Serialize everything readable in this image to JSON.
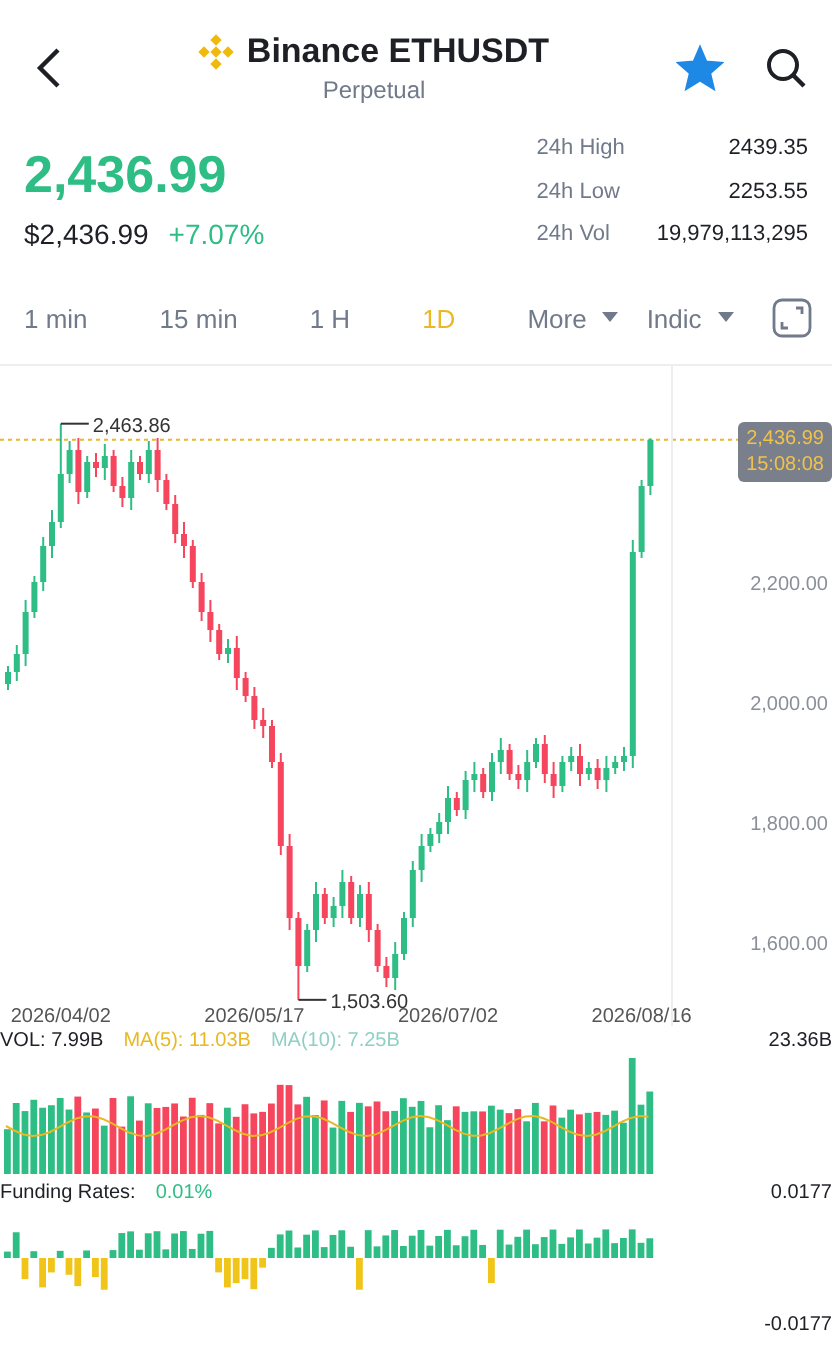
{
  "header": {
    "title": "Binance ETHUSDT",
    "subtitle": "Perpetual",
    "favorite": true
  },
  "price": {
    "last": "2,436.99",
    "usd": "$2,436.99",
    "change": "+7.07%"
  },
  "stats": [
    {
      "label": "24h High",
      "value": "2439.35"
    },
    {
      "label": "24h Low",
      "value": "2253.55"
    },
    {
      "label": "24h Vol",
      "value": "19,979,113,295"
    }
  ],
  "intervals": [
    {
      "label": "1 min",
      "selected": false
    },
    {
      "label": "15 min",
      "selected": false
    },
    {
      "label": "1 H",
      "selected": false
    },
    {
      "label": "1D",
      "selected": true
    }
  ],
  "dropdowns": [
    {
      "label": "More"
    },
    {
      "label": "Indic"
    }
  ],
  "chart": {
    "chart_data": {
      "type": "candlestick",
      "categories": [
        null,
        null,
        null,
        null,
        null,
        null,
        "2026/04/02",
        null,
        null,
        null,
        null,
        null,
        null,
        null,
        null,
        null,
        null,
        null,
        null,
        null,
        null,
        null,
        null,
        null,
        null,
        null,
        null,
        null,
        "2026/05/17",
        null,
        null,
        null,
        null,
        null,
        null,
        null,
        null,
        null,
        null,
        null,
        null,
        null,
        null,
        null,
        null,
        null,
        null,
        null,
        null,
        null,
        "2026/07/02",
        null,
        null,
        null,
        null,
        null,
        null,
        null,
        null,
        null,
        null,
        null,
        null,
        null,
        null,
        null,
        null,
        null,
        null,
        null,
        null,
        null,
        "2026/08/16",
        null
      ],
      "ohlc": [
        [
          2030,
          2060,
          2020,
          2050
        ],
        [
          2050,
          2095,
          2035,
          2080
        ],
        [
          2080,
          2170,
          2060,
          2150
        ],
        [
          2150,
          2210,
          2140,
          2200
        ],
        [
          2200,
          2275,
          2185,
          2260
        ],
        [
          2260,
          2320,
          2240,
          2300
        ],
        [
          2300,
          2463.86,
          2290,
          2380
        ],
        [
          2380,
          2435,
          2365,
          2420
        ],
        [
          2420,
          2440,
          2330,
          2350
        ],
        [
          2350,
          2410,
          2340,
          2400
        ],
        [
          2400,
          2415,
          2375,
          2390
        ],
        [
          2390,
          2430,
          2370,
          2410
        ],
        [
          2410,
          2420,
          2350,
          2360
        ],
        [
          2360,
          2375,
          2325,
          2340
        ],
        [
          2340,
          2420,
          2320,
          2400
        ],
        [
          2400,
          2410,
          2370,
          2380
        ],
        [
          2380,
          2435,
          2365,
          2420
        ],
        [
          2420,
          2440,
          2350,
          2370
        ],
        [
          2370,
          2380,
          2320,
          2330
        ],
        [
          2330,
          2345,
          2265,
          2280
        ],
        [
          2280,
          2300,
          2240,
          2260
        ],
        [
          2260,
          2270,
          2190,
          2200
        ],
        [
          2200,
          2215,
          2135,
          2150
        ],
        [
          2150,
          2170,
          2100,
          2120
        ],
        [
          2120,
          2130,
          2070,
          2080
        ],
        [
          2080,
          2105,
          2065,
          2090
        ],
        [
          2090,
          2110,
          2020,
          2040
        ],
        [
          2040,
          2050,
          2000,
          2010
        ],
        [
          2010,
          2025,
          1955,
          1970
        ],
        [
          1970,
          1990,
          1940,
          1960
        ],
        [
          1960,
          1970,
          1890,
          1900
        ],
        [
          1900,
          1915,
          1745,
          1760
        ],
        [
          1760,
          1780,
          1620,
          1640
        ],
        [
          1640,
          1650,
          1503.6,
          1560
        ],
        [
          1560,
          1630,
          1550,
          1620
        ],
        [
          1620,
          1700,
          1600,
          1680
        ],
        [
          1680,
          1690,
          1630,
          1640
        ],
        [
          1640,
          1675,
          1625,
          1660
        ],
        [
          1660,
          1720,
          1640,
          1700
        ],
        [
          1700,
          1710,
          1630,
          1640
        ],
        [
          1640,
          1695,
          1625,
          1680
        ],
        [
          1680,
          1700,
          1600,
          1620
        ],
        [
          1620,
          1630,
          1550,
          1560
        ],
        [
          1560,
          1575,
          1525,
          1540
        ],
        [
          1540,
          1600,
          1520,
          1580
        ],
        [
          1580,
          1650,
          1570,
          1640
        ],
        [
          1640,
          1735,
          1625,
          1720
        ],
        [
          1720,
          1780,
          1700,
          1760
        ],
        [
          1760,
          1790,
          1750,
          1780
        ],
        [
          1780,
          1815,
          1765,
          1800
        ],
        [
          1800,
          1860,
          1780,
          1840
        ],
        [
          1840,
          1850,
          1810,
          1820
        ],
        [
          1820,
          1885,
          1805,
          1870
        ],
        [
          1870,
          1900,
          1850,
          1880
        ],
        [
          1880,
          1890,
          1840,
          1850
        ],
        [
          1850,
          1915,
          1835,
          1900
        ],
        [
          1900,
          1940,
          1880,
          1920
        ],
        [
          1920,
          1930,
          1870,
          1880
        ],
        [
          1880,
          1895,
          1855,
          1870
        ],
        [
          1870,
          1920,
          1850,
          1900
        ],
        [
          1900,
          1940,
          1890,
          1930
        ],
        [
          1930,
          1945,
          1865,
          1880
        ],
        [
          1880,
          1900,
          1840,
          1860
        ],
        [
          1860,
          1910,
          1850,
          1900
        ],
        [
          1900,
          1925,
          1885,
          1910
        ],
        [
          1910,
          1930,
          1860,
          1880
        ],
        [
          1880,
          1900,
          1870,
          1890
        ],
        [
          1890,
          1905,
          1855,
          1870
        ],
        [
          1870,
          1910,
          1850,
          1890
        ],
        [
          1890,
          1910,
          1880,
          1900
        ],
        [
          1900,
          1925,
          1885,
          1910
        ],
        [
          1910,
          2270,
          1890,
          2250
        ],
        [
          2250,
          2370,
          2240,
          2360
        ],
        [
          2360,
          2439.35,
          2345,
          2436.99
        ]
      ],
      "ref_lines": [
        {
          "axis": "y",
          "value": 2436.99,
          "color": "#e8b923"
        }
      ],
      "ylim": [
        1460,
        2560
      ],
      "yticks": [
        {
          "value": 1600,
          "label": "1,600.00"
        },
        {
          "value": 1800,
          "label": "1,800.00"
        },
        {
          "value": 2000,
          "label": "2,000.00"
        },
        {
          "value": 2200,
          "label": "2,200.00"
        }
      ],
      "annotations": [
        "2,463.86",
        "1,503.60"
      ]
    },
    "last_tag": {
      "price": "2,436.99",
      "countdown": "15:08:08"
    }
  },
  "volume": {
    "label": "VOL: 7.99B",
    "ma5": "MA(5): 11.03B",
    "ma10": "MA(10): 7.25B",
    "max": "23.36B"
  },
  "funding": {
    "label": "Funding Rates:",
    "value": "0.01%",
    "max": "0.0177",
    "min": "-0.0177"
  }
}
